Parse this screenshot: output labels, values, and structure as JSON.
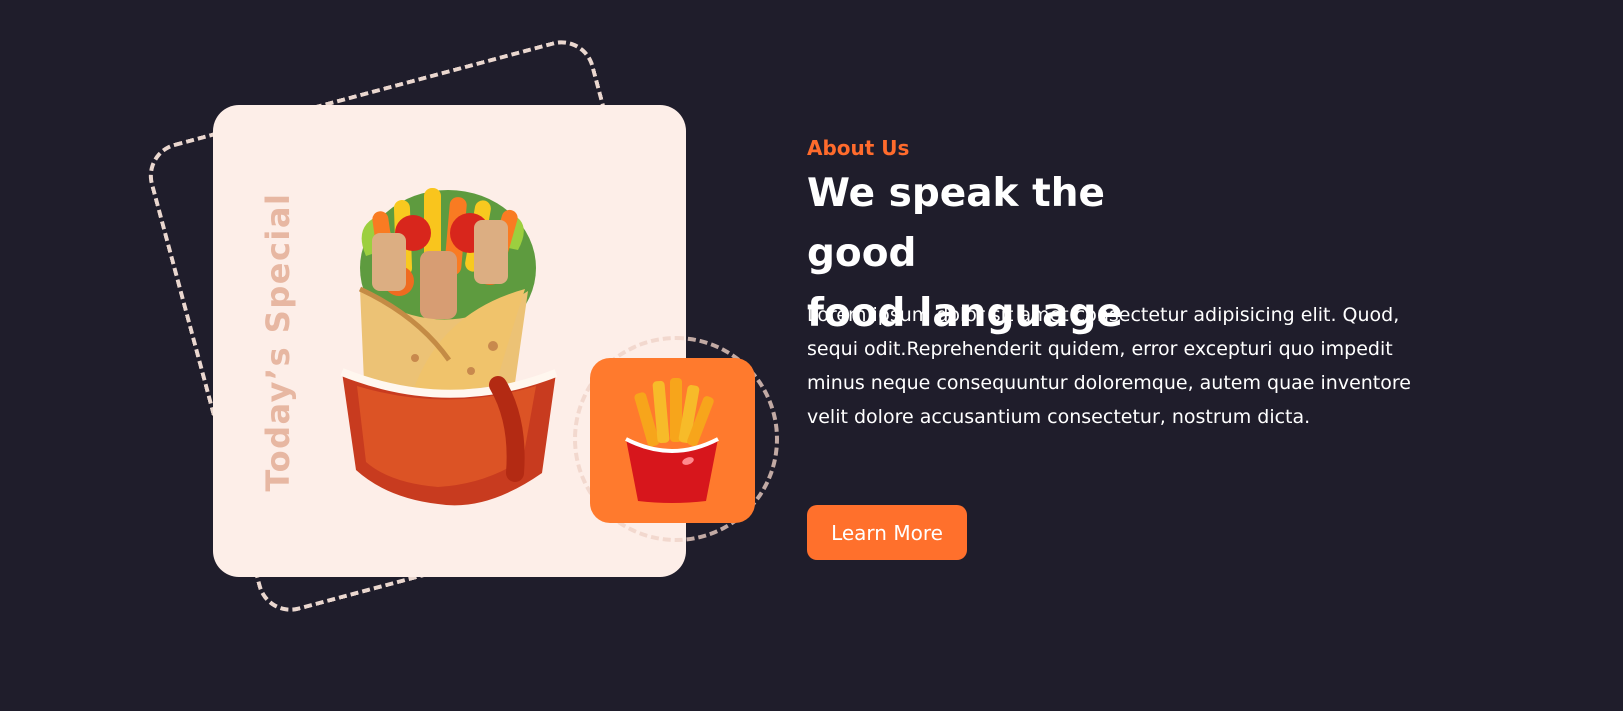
{
  "about": {
    "eyebrow": "About Us",
    "title_line_1": "We speak the good",
    "title_line_2": "food language",
    "body_text": "Lorem ipsum dolor sit amet consectetur adipisicing elit. Quod, sequi odit.Reprehenderit quidem, error excepturi quo impedit minus neque consequuntur doloremque, autem quae inventore velit dolore accusantium consectetur, nostrum dicta.",
    "cta_label": "Learn More"
  },
  "promo": {
    "vertical_label": "Today’s Special"
  },
  "icons": {
    "main_food": "wrap-icon",
    "secondary_food": "fries-icon"
  },
  "colors": {
    "background": "#1f1d2b",
    "card": "#fdeee8",
    "accent": "#ff702c",
    "dashed": "#ead7cf",
    "vertical_text": "#e7b7a2"
  }
}
